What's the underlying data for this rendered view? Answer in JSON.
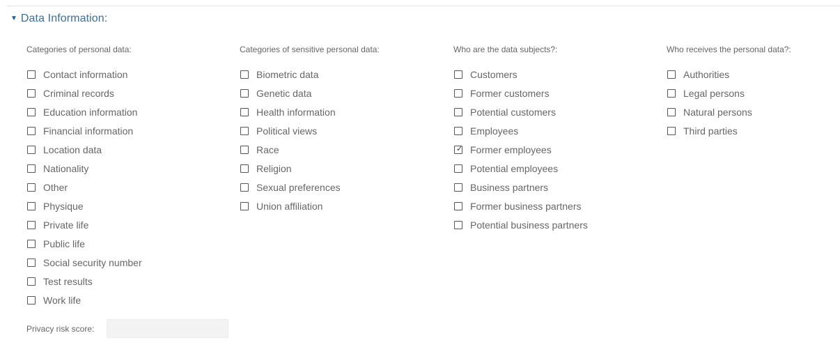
{
  "section": {
    "title": "Data Information:",
    "expanded": true
  },
  "columns": [
    {
      "title": "Categories of personal data:",
      "options": [
        {
          "label": "Contact information",
          "checked": false
        },
        {
          "label": "Criminal records",
          "checked": false
        },
        {
          "label": "Education information",
          "checked": false
        },
        {
          "label": "Financial information",
          "checked": false
        },
        {
          "label": "Location data",
          "checked": false
        },
        {
          "label": "Nationality",
          "checked": false
        },
        {
          "label": "Other",
          "checked": false
        },
        {
          "label": "Physique",
          "checked": false
        },
        {
          "label": "Private life",
          "checked": false
        },
        {
          "label": "Public life",
          "checked": false
        },
        {
          "label": "Social security number",
          "checked": false
        },
        {
          "label": "Test results",
          "checked": false
        },
        {
          "label": "Work life",
          "checked": false
        }
      ]
    },
    {
      "title": "Categories of sensitive personal data:",
      "options": [
        {
          "label": "Biometric data",
          "checked": false
        },
        {
          "label": "Genetic data",
          "checked": false
        },
        {
          "label": "Health information",
          "checked": false
        },
        {
          "label": "Political views",
          "checked": false
        },
        {
          "label": "Race",
          "checked": false
        },
        {
          "label": "Religion",
          "checked": false
        },
        {
          "label": "Sexual preferences",
          "checked": false
        },
        {
          "label": "Union affiliation",
          "checked": false
        }
      ]
    },
    {
      "title": "Who are the data subjects?:",
      "options": [
        {
          "label": "Customers",
          "checked": false
        },
        {
          "label": "Former customers",
          "checked": false
        },
        {
          "label": "Potential customers",
          "checked": false
        },
        {
          "label": "Employees",
          "checked": false
        },
        {
          "label": "Former employees",
          "checked": true
        },
        {
          "label": "Potential employees",
          "checked": false
        },
        {
          "label": "Business partners",
          "checked": false
        },
        {
          "label": "Former business partners",
          "checked": false
        },
        {
          "label": "Potential business partners",
          "checked": false
        }
      ]
    },
    {
      "title": "Who receives the personal data?:",
      "options": [
        {
          "label": "Authorities",
          "checked": false
        },
        {
          "label": "Legal persons",
          "checked": false
        },
        {
          "label": "Natural persons",
          "checked": false
        },
        {
          "label": "Third parties",
          "checked": false
        }
      ]
    }
  ],
  "privacy_risk": {
    "label": "Privacy risk score:",
    "value": ""
  },
  "icons": {
    "caret": "caret-down-icon",
    "checkbox": "checkbox-icon",
    "check": "checkmark-icon"
  },
  "colors": {
    "header_text": "#3a6f9c",
    "caret": "#1f5f92",
    "label_text": "#666666",
    "checkbox_border": "#555555",
    "field_bg": "#f3f3f3"
  }
}
